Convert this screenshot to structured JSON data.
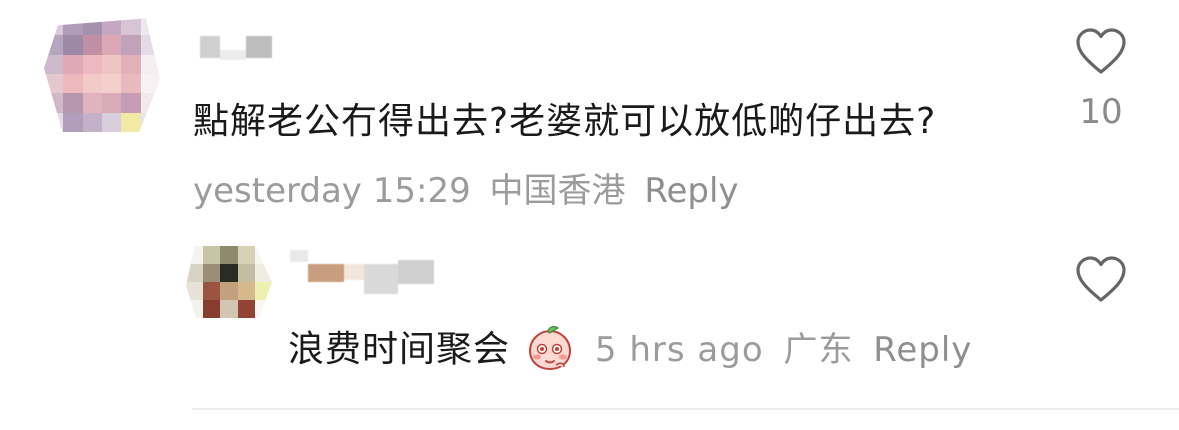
{
  "comments": [
    {
      "text": "點解老公冇得出去?老婆就可以放低啲仔出去?",
      "timestamp": "yesterday 15:29",
      "region": "中国香港",
      "reply_label": "Reply",
      "like_count": "10",
      "icons": {
        "avatar": "blurred-avatar",
        "like": "heart-outline-icon"
      }
    },
    {
      "text": "浪费时间聚会",
      "emoji": "blushing-peach-emoji",
      "timestamp": "5 hrs ago",
      "region": "广东",
      "reply_label": "Reply",
      "icons": {
        "avatar": "blurred-avatar",
        "like": "heart-outline-icon"
      }
    }
  ],
  "colors": {
    "text_primary": "#1a1a1a",
    "text_secondary": "#9b9b9b",
    "heart_stroke": "#666666",
    "divider": "#ececec"
  }
}
